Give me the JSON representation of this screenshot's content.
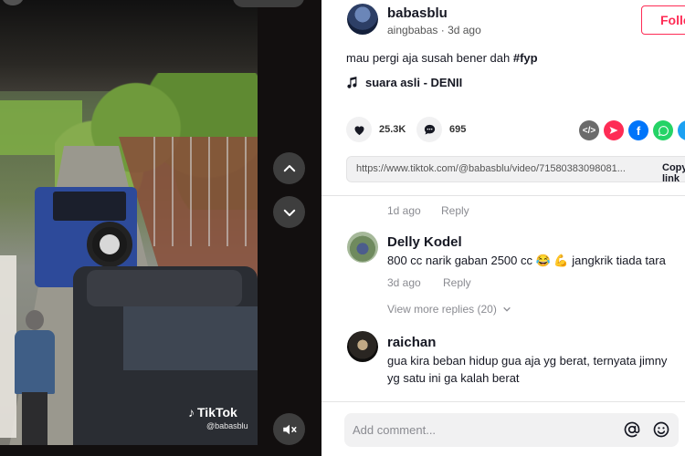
{
  "video": {
    "watermark_brand": "TikTok",
    "watermark_handle": "@babasblu"
  },
  "author": {
    "username": "babasblu",
    "display_name": "aingbabas",
    "posted": "3d ago",
    "meta_separator": " · ",
    "follow_label": "Follow"
  },
  "post": {
    "caption": "mau pergi aja susah bener dah ",
    "hashtag": "#fyp",
    "music": "suara asli - DENII"
  },
  "actions": {
    "likes": "25.3K",
    "comments": "695"
  },
  "share": {
    "url": "https://www.tiktok.com/@babasblu/video/71580383098081...",
    "copy_label": "Copy link"
  },
  "comments": {
    "prev_meta": {
      "time": "1d ago",
      "reply": "Reply"
    },
    "items": [
      {
        "name": "Delly Kodel",
        "text": "800 cc narik gaban 2500 cc 😂 💪 jangkrik tiada tara",
        "time": "3d ago",
        "reply": "Reply",
        "view_replies": "View more replies (20)"
      },
      {
        "name": "raichan",
        "text_line1": "gua kira beban hidup gua aja yg berat, ternyata jimny",
        "text_line2": "yg satu ini ga kalah berat"
      }
    ]
  },
  "composer": {
    "placeholder": "Add comment..."
  },
  "colors": {
    "accent": "#fe2c55",
    "facebook": "#0075fa",
    "whatsapp": "#25d366",
    "twitter": "#1da1f2"
  },
  "icons": [
    "chevron-up-icon",
    "chevron-down-icon",
    "mute-icon",
    "music-note-icon",
    "heart-icon",
    "comment-icon",
    "embed-icon",
    "send-icon",
    "facebook-icon",
    "whatsapp-icon",
    "twitter-icon",
    "at-icon",
    "emoji-icon"
  ]
}
